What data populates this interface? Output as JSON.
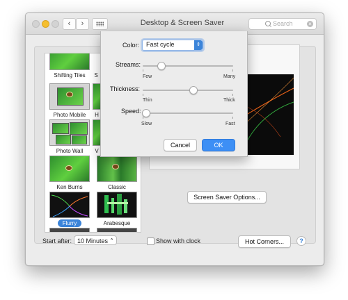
{
  "window": {
    "title": "Desktop & Screen Saver"
  },
  "toolbar": {
    "back": "‹",
    "forward": "›",
    "search_placeholder": "Search"
  },
  "savers": [
    {
      "label": "Shifting Tiles"
    },
    {
      "label": "S"
    },
    {
      "label": "Photo Mobile"
    },
    {
      "label": "H"
    },
    {
      "label": "Photo Wall"
    },
    {
      "label": "V"
    },
    {
      "label": "Ken Burns"
    },
    {
      "label": "Classic"
    },
    {
      "label": "Flurry",
      "selected": true
    },
    {
      "label": "Arabesque"
    }
  ],
  "preview": {
    "options_button": "Screen Saver Options..."
  },
  "footer": {
    "start_after_label": "Start after:",
    "start_after_value": "10 Minutes",
    "show_clock_label": "Show with clock",
    "hot_corners_button": "Hot Corners...",
    "help": "?"
  },
  "sheet": {
    "color_label": "Color:",
    "color_value": "Fast cycle",
    "streams_label": "Streams:",
    "streams_min": "Few",
    "streams_max": "Many",
    "streams_value": 0.2,
    "thickness_label": "Thickness:",
    "thickness_min": "Thin",
    "thickness_max": "Thick",
    "thickness_value": 0.55,
    "speed_label": "Speed:",
    "speed_min": "Slow",
    "speed_max": "Fast",
    "speed_value": 0.03,
    "cancel_button": "Cancel",
    "ok_button": "OK"
  },
  "colors": {
    "accent": "#3d8ff5",
    "selection": "#3b84d9"
  }
}
